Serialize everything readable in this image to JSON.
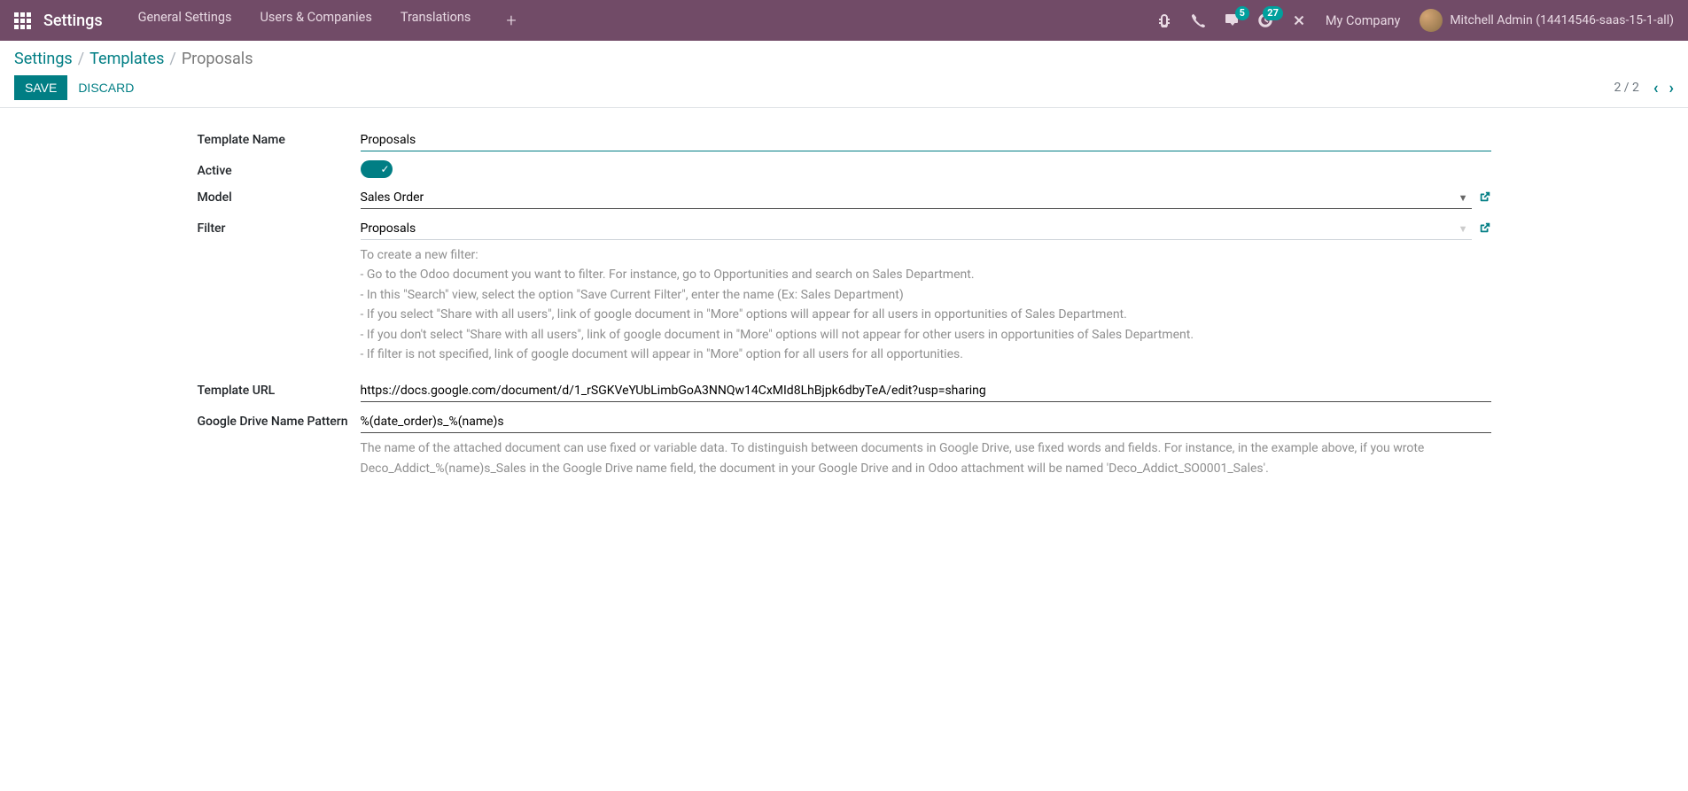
{
  "navbar": {
    "brand": "Settings",
    "menu": [
      "General Settings",
      "Users & Companies",
      "Translations"
    ],
    "messages_badge": "5",
    "activities_badge": "27",
    "company": "My Company",
    "user_name": "Mitchell Admin (14414546-saas-15-1-all)"
  },
  "breadcrumbs": {
    "root": "Settings",
    "parent": "Templates",
    "current": "Proposals"
  },
  "actions": {
    "save": "SAVE",
    "discard": "DISCARD",
    "pager": "2 / 2"
  },
  "form": {
    "labels": {
      "template_name": "Template Name",
      "active": "Active",
      "model": "Model",
      "filter": "Filter",
      "template_url": "Template URL",
      "name_pattern": "Google Drive Name Pattern"
    },
    "values": {
      "template_name": "Proposals",
      "model": "Sales Order",
      "filter": "Proposals",
      "template_url": "https://docs.google.com/document/d/1_rSGKVeYUbLimbGoA3NNQw14CxMId8LhBjpk6dbyTeA/edit?usp=sharing",
      "name_pattern": "%(date_order)s_%(name)s"
    },
    "filter_help": {
      "title": "To create a new filter:",
      "lines": [
        "- Go to the Odoo document you want to filter. For instance, go to Opportunities and search on Sales Department.",
        "- In this \"Search\" view, select the option \"Save Current Filter\", enter the name (Ex: Sales Department)",
        "- If you select \"Share with all users\", link of google document in \"More\" options will appear for all users in opportunities of Sales Department.",
        "- If you don't select \"Share with all users\", link of google document in \"More\" options will not appear for other users in opportunities of Sales Department.",
        "- If filter is not specified, link of google document will appear in \"More\" option for all users for all opportunities."
      ]
    },
    "pattern_help": "The name of the attached document can use fixed or variable data. To distinguish between documents in Google Drive, use fixed words and fields. For instance, in the example above, if you wrote Deco_Addict_%(name)s_Sales in the Google Drive name field, the document in your Google Drive and in Odoo attachment will be named 'Deco_Addict_SO0001_Sales'."
  }
}
